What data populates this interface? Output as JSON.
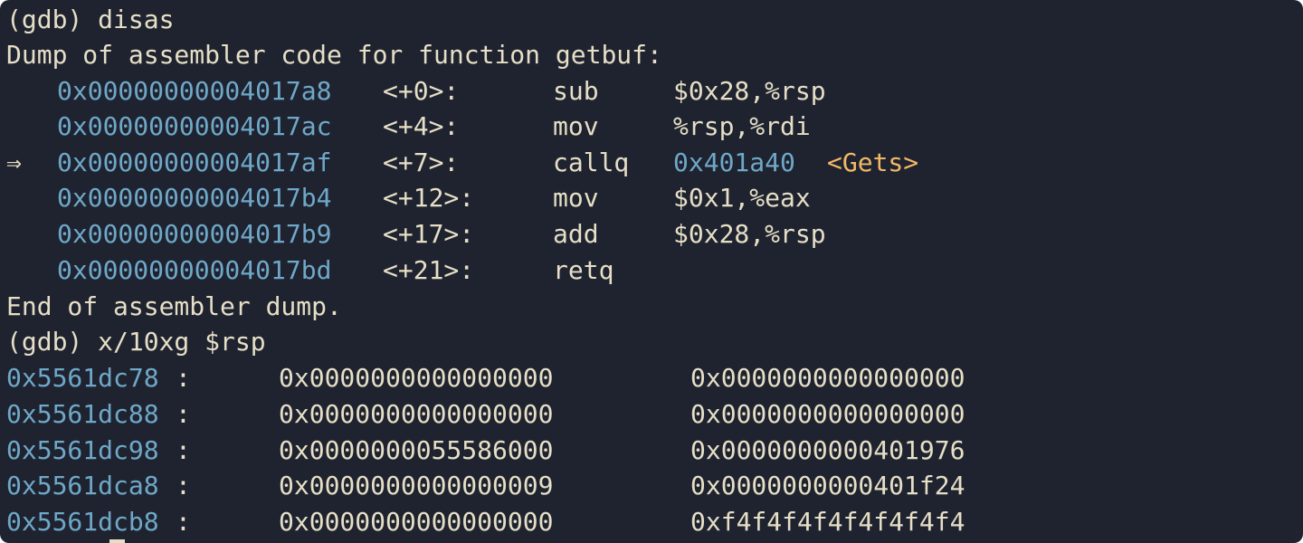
{
  "terminal": {
    "prompt1": "(gdb) disas",
    "dump_header": "Dump of assembler code for function getbuf:",
    "current_marker": "⇒",
    "instructions": [
      {
        "address": "0x00000000004017a8",
        "offset": "<+0>:",
        "mnemonic": "sub",
        "operands": "$0x28,%rsp",
        "target": "",
        "symbol": ""
      },
      {
        "address": "0x00000000004017ac",
        "offset": "<+4>:",
        "mnemonic": "mov",
        "operands": "%rsp,%rdi",
        "target": "",
        "symbol": ""
      },
      {
        "address": "0x00000000004017af",
        "offset": "<+7>:",
        "mnemonic": "callq",
        "operands": "",
        "target": "0x401a40",
        "symbol": "<Gets>"
      },
      {
        "address": "0x00000000004017b4",
        "offset": "<+12>:",
        "mnemonic": "mov",
        "operands": "$0x1,%eax",
        "target": "",
        "symbol": ""
      },
      {
        "address": "0x00000000004017b9",
        "offset": "<+17>:",
        "mnemonic": "add",
        "operands": "$0x28,%rsp",
        "target": "",
        "symbol": ""
      },
      {
        "address": "0x00000000004017bd",
        "offset": "<+21>:",
        "mnemonic": "retq",
        "operands": "",
        "target": "",
        "symbol": ""
      }
    ],
    "dump_footer": "End of assembler dump.",
    "prompt2": "(gdb) x/10xg $rsp",
    "memory": [
      {
        "address": "0x5561dc78",
        "colon": ":",
        "word1": "0x0000000000000000",
        "word2": "0x0000000000000000"
      },
      {
        "address": "0x5561dc88",
        "colon": ":",
        "word1": "0x0000000000000000",
        "word2": "0x0000000000000000"
      },
      {
        "address": "0x5561dc98",
        "colon": ":",
        "word1": "0x0000000055586000",
        "word2": "0x0000000000401976"
      },
      {
        "address": "0x5561dca8",
        "colon": ":",
        "word1": "0x0000000000000009",
        "word2": "0x0000000000401f24"
      },
      {
        "address": "0x5561dcb8",
        "colon": ":",
        "word1": "0x0000000000000000",
        "word2": "0xf4f4f4f4f4f4f4f4"
      }
    ]
  },
  "colors": {
    "background": "#1f2330",
    "text": "#e6dfc6",
    "address": "#6fa8c8",
    "symbol": "#f2b866"
  }
}
